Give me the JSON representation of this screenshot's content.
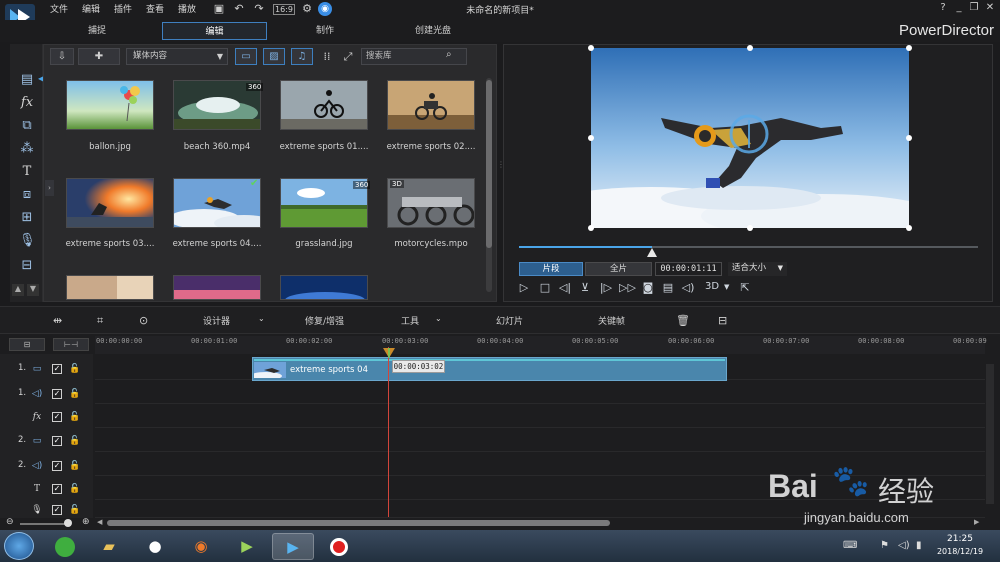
{
  "menu": {
    "items": [
      "文件",
      "编辑",
      "插件",
      "查看",
      "播放"
    ]
  },
  "window": {
    "title": "未命名的新项目*",
    "brand": "PowerDirector"
  },
  "modes": {
    "tabs": [
      "捕捉",
      "编辑",
      "制作",
      "创建光盘"
    ],
    "active": "编辑"
  },
  "library": {
    "dropdown_value": "媒体内容",
    "search_placeholder": "搜索库",
    "items": [
      {
        "name": "ballon.jpg",
        "badge": ""
      },
      {
        "name": "beach 360.mp4",
        "badge": "360"
      },
      {
        "name": "extreme sports 01....",
        "badge": ""
      },
      {
        "name": "extreme sports 02....",
        "badge": ""
      },
      {
        "name": "extreme sports 03....",
        "badge": ""
      },
      {
        "name": "extreme sports 04....",
        "badge": ""
      },
      {
        "name": "grassland.jpg",
        "badge": "360"
      },
      {
        "name": "motorcycles.mpo",
        "badge": "3D"
      }
    ]
  },
  "preview": {
    "clip_tab": "片段",
    "full_tab": "全片",
    "timecode": "00:00:01:11",
    "fit": "适合大小",
    "mode_3d": "3D",
    "scrub_progress": 0.29
  },
  "edit_toolbar": {
    "designer": "设计器",
    "fix": "修复/增强",
    "tools": "工具",
    "slideshow": "幻灯片",
    "keyframe": "关键帧"
  },
  "timeline": {
    "ruler": [
      "00:00:00:00",
      "00:00:01:00",
      "00:00:02:00",
      "00:00:03:00",
      "00:00:04:00",
      "00:00:05:00",
      "00:00:06:00",
      "00:00:07:00",
      "00:00:08:00",
      "00:00:09"
    ],
    "tracks": [
      {
        "num": "1.",
        "icon": "video-track-icon"
      },
      {
        "num": "1.",
        "icon": "audio-track-icon"
      },
      {
        "num": "",
        "icon": "fx-track-icon"
      },
      {
        "num": "2.",
        "icon": "video-track-icon"
      },
      {
        "num": "2.",
        "icon": "audio-track-icon"
      },
      {
        "num": "",
        "icon": "title-track-icon"
      },
      {
        "num": "",
        "icon": "voice-track-icon"
      }
    ],
    "clip_label": "extreme sports 04",
    "playhead_tc": "00:00:03:02"
  },
  "taskbar": {
    "time": "21:25",
    "date": "2018/12/19"
  },
  "watermark": {
    "brand": "Bai",
    "brand2": "经验",
    "url": "jingyan.baidu.com"
  },
  "colors": {
    "accent": "#4aa4e8",
    "clip": "#4a86ac",
    "playhead": "#d2453b"
  }
}
